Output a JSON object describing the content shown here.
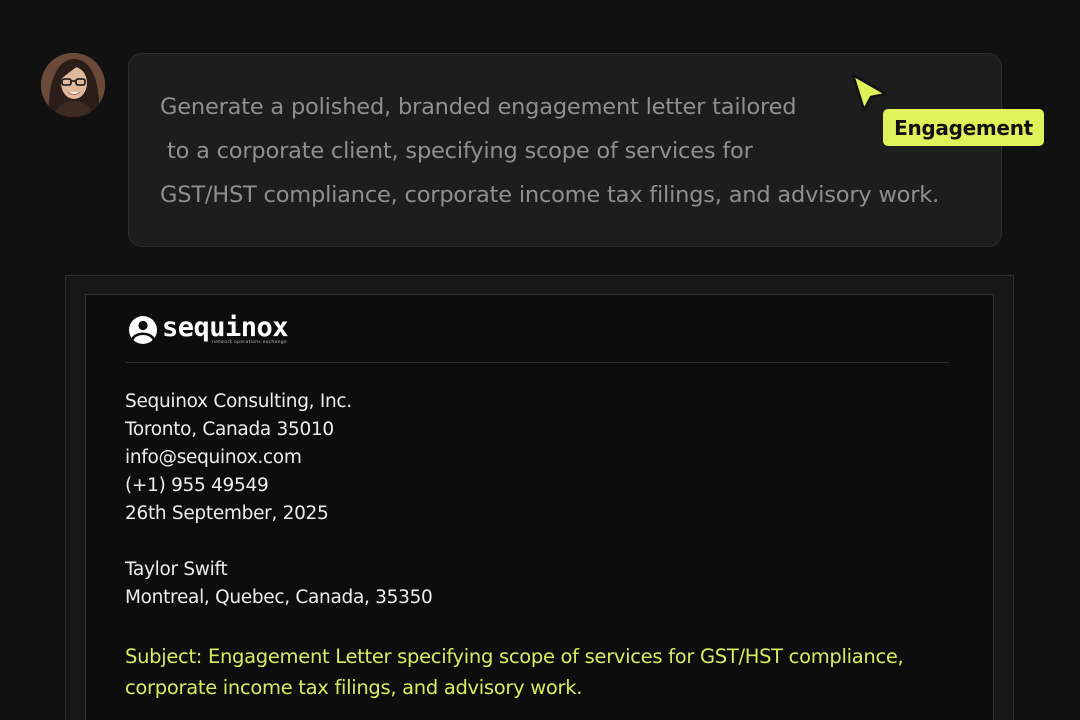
{
  "prompt": {
    "lines": [
      "Generate a polished, branded engagement letter tailored",
      " to a corporate client, specifying scope of services for",
      "GST/HST compliance, corporate income tax filings, and advisory work."
    ]
  },
  "cursor_tag": {
    "label": "Engagement",
    "color": "#dff25a",
    "icon": "cursor-arrow-icon"
  },
  "letter": {
    "logo": {
      "name": "sequinox",
      "tagline": "network operations exchange",
      "icon": "sequinox-logo-icon"
    },
    "sender": [
      "Sequinox Consulting, Inc.",
      "Toronto, Canada 35010",
      "info@sequinox.com",
      "(+1) 955 49549",
      "26th September, 2025"
    ],
    "recipient": [
      "Taylor Swift",
      "Montreal, Quebec, Canada, 35350"
    ],
    "subject": [
      "Subject: Engagement Letter specifying scope of services for GST/HST compliance,",
      "corporate income tax filings, and advisory work."
    ],
    "subject_color": "#d7ec62"
  },
  "colors": {
    "background": "#111111",
    "accent": "#dff25a"
  }
}
